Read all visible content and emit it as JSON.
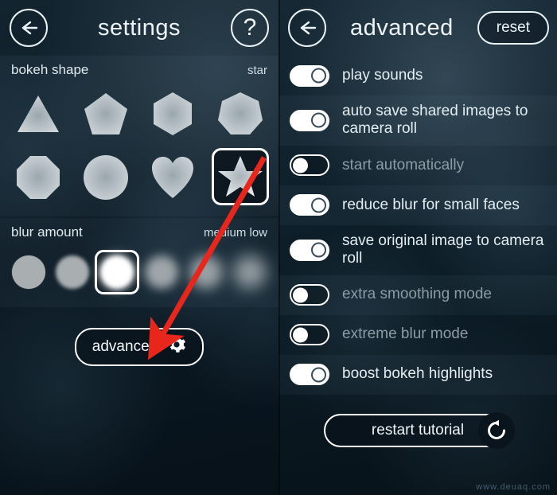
{
  "left": {
    "header": {
      "back_icon": "arrow-left-icon",
      "title": "settings",
      "help_label": "?"
    },
    "bokeh_section": {
      "title": "bokeh shape",
      "value": "star",
      "shapes": [
        {
          "name": "triangle",
          "selected": false
        },
        {
          "name": "pentagon",
          "selected": false
        },
        {
          "name": "hexagon",
          "selected": false
        },
        {
          "name": "heptagon",
          "selected": false
        },
        {
          "name": "octagon",
          "selected": false
        },
        {
          "name": "circle",
          "selected": false
        },
        {
          "name": "heart",
          "selected": false
        },
        {
          "name": "star",
          "selected": true
        }
      ]
    },
    "blur_section": {
      "title": "blur amount",
      "value": "medium low",
      "steps": [
        {
          "index": 1,
          "selected": false
        },
        {
          "index": 2,
          "selected": false
        },
        {
          "index": 3,
          "selected": true
        },
        {
          "index": 4,
          "selected": false
        },
        {
          "index": 5,
          "selected": false
        },
        {
          "index": 6,
          "selected": false
        }
      ]
    },
    "advanced_button": {
      "label": "advanced",
      "icon": "gear-icon"
    }
  },
  "right": {
    "header": {
      "back_icon": "arrow-left-icon",
      "title": "advanced",
      "reset_label": "reset"
    },
    "options": [
      {
        "label": "play sounds",
        "state": "on",
        "enabled": true
      },
      {
        "label": "auto save shared images to camera roll",
        "state": "on",
        "enabled": true
      },
      {
        "label": "start automatically",
        "state": "off",
        "enabled": false
      },
      {
        "label": "reduce blur for small faces",
        "state": "on",
        "enabled": true
      },
      {
        "label": "save original image to camera roll",
        "state": "on",
        "enabled": true
      },
      {
        "label": "extra smoothing mode",
        "state": "off",
        "enabled": false
      },
      {
        "label": "extreme blur mode",
        "state": "off",
        "enabled": false
      },
      {
        "label": "boost bokeh highlights",
        "state": "on",
        "enabled": true
      }
    ],
    "restart_button": {
      "label": "restart tutorial",
      "icon": "refresh-icon"
    }
  },
  "annotation": {
    "arrow_color": "#e8261c",
    "from": "bokeh-star-cell",
    "to": "advanced-button"
  },
  "watermark": "www.deuaq.com",
  "colors": {
    "accent": "#ffffff",
    "panel_dark": "#0d1b26",
    "text": "#e4edf2",
    "text_disabled": "#8d9ba4",
    "arrow_red": "#e8261c"
  }
}
